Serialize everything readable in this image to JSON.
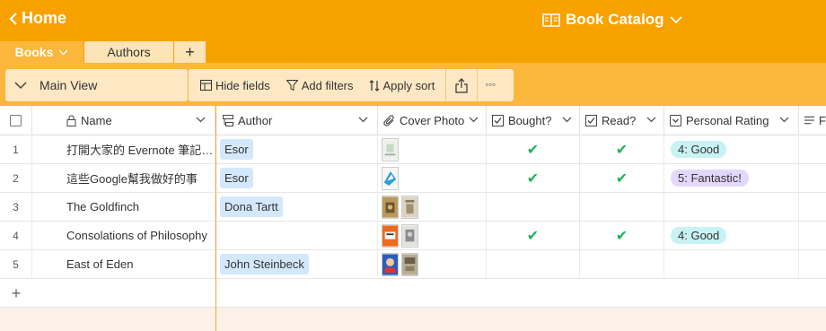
{
  "topbar": {
    "home_label": "Home",
    "base_title": "Book Catalog"
  },
  "tabs": [
    {
      "label": "Books"
    },
    {
      "label": "Authors"
    },
    {
      "label": "+"
    }
  ],
  "viewbar": {
    "view_name": "Main View",
    "hide_fields": "Hide fields",
    "add_filters": "Add filters",
    "apply_sort": "Apply sort",
    "more": "◦◦◦"
  },
  "columns": [
    {
      "label": "Name",
      "icon": "lock-icon"
    },
    {
      "label": "Author",
      "icon": "link-record-icon"
    },
    {
      "label": "Cover Photo",
      "icon": "attachment-icon"
    },
    {
      "label": "Bought?",
      "icon": "checkbox-icon"
    },
    {
      "label": "Read?",
      "icon": "checkbox-icon"
    },
    {
      "label": "Personal Rating",
      "icon": "single-select-icon"
    },
    {
      "label": "F",
      "icon": "long-text-icon"
    }
  ],
  "rows": [
    {
      "num": "1",
      "name": "打開大家的 Evernote 筆記…",
      "author": "Esor",
      "bought": "✔",
      "read": "✔",
      "rating": "4: Good"
    },
    {
      "num": "2",
      "name": "這些Google幫我做好的事",
      "author": "Esor",
      "bought": "✔",
      "read": "✔",
      "rating": "5: Fantastic!"
    },
    {
      "num": "3",
      "name": "The Goldfinch",
      "author": "Dona Tartt",
      "bought": "",
      "read": "",
      "rating": ""
    },
    {
      "num": "4",
      "name": "Consolations of Philosophy",
      "author": "",
      "bought": "✔",
      "read": "✔",
      "rating": "4: Good"
    },
    {
      "num": "5",
      "name": "East of Eden",
      "author": "John Steinbeck",
      "bought": "",
      "read": "",
      "rating": ""
    }
  ],
  "add_row_label": "+",
  "colors": {
    "header_orange": "#f8a200",
    "toolbar_orange": "#fbb73b",
    "check_green": "#20b25a",
    "good_pill": "#c8f2f4",
    "fantastic_pill": "#e3d8fb"
  }
}
